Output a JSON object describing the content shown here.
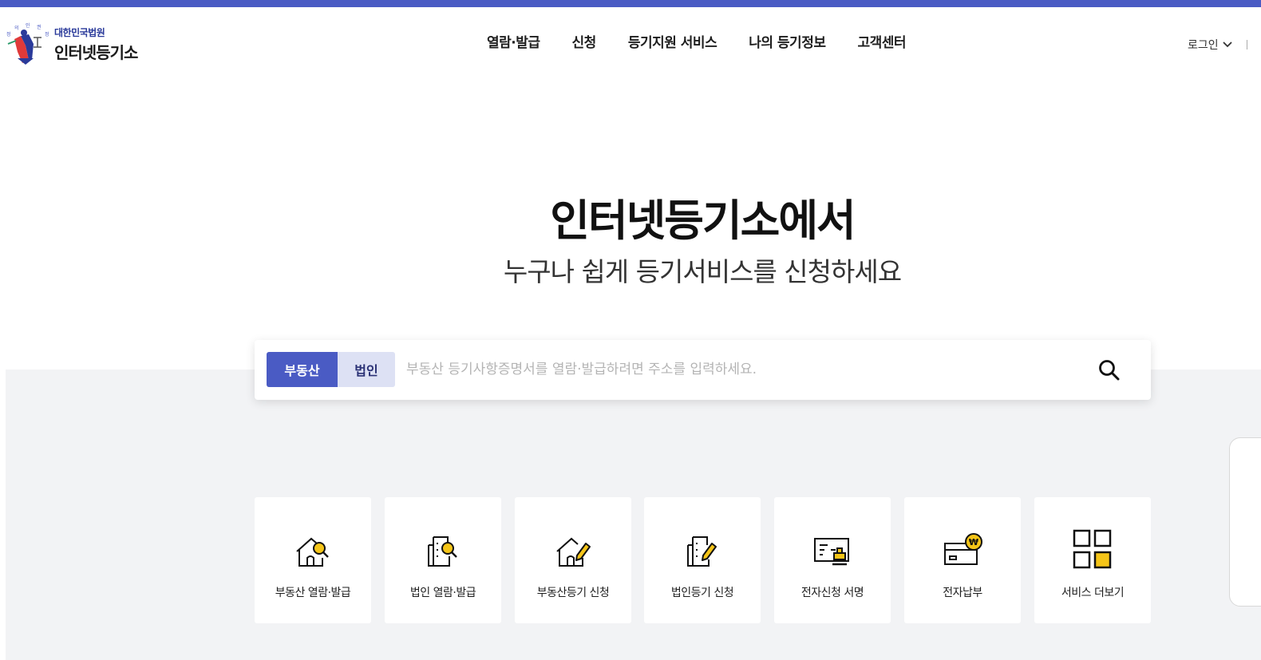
{
  "header": {
    "logo_sub": "대한민국법원",
    "logo_main": "인터넷등기소",
    "nav": [
      "열람·발급",
      "신청",
      "등기지원 서비스",
      "나의 등기정보",
      "고객센터"
    ],
    "login_label": "로그인"
  },
  "hero": {
    "title": "인터넷등기소에서",
    "subtitle": "누구나 쉽게 등기서비스를 신청하세요"
  },
  "search": {
    "tabs": [
      "부동산",
      "법인"
    ],
    "active_tab": "부동산",
    "placeholder": "부동산 등기사항증명서를 열람·발급하려면 주소를 입력하세요.",
    "value": ""
  },
  "services": [
    {
      "label": "부동산 열람·발급",
      "icon": "house-search-icon"
    },
    {
      "label": "법인 열람·발급",
      "icon": "building-search-icon"
    },
    {
      "label": "부동산등기 신청",
      "icon": "house-pen-icon"
    },
    {
      "label": "법인등기 신청",
      "icon": "building-pen-icon"
    },
    {
      "label": "전자신청 서명",
      "icon": "document-stamp-icon"
    },
    {
      "label": "전자납부",
      "icon": "card-won-icon"
    },
    {
      "label": "서비스 더보기",
      "icon": "grid-more-icon"
    }
  ],
  "colors": {
    "brand": "#4a5bc4",
    "brand_light": "#dde1f4",
    "accent_yellow": "#f5c518",
    "background_gray": "#f2f3f5"
  }
}
